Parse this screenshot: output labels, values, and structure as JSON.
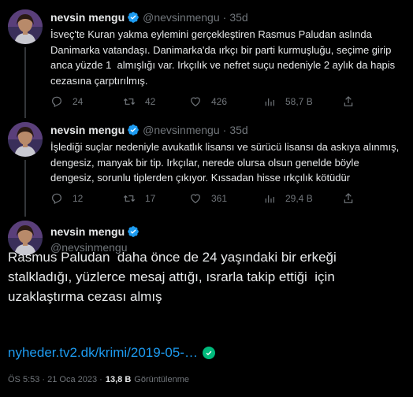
{
  "user": {
    "name": "nevsin mengu",
    "handle": "@nevsinmengu"
  },
  "thread": [
    {
      "time": "35d",
      "text": "İsveç'te Kuran yakma eylemini gerçekleştiren Rasmus Paludan aslında\nDanimarka vatandaşı. Danimarka'da ırkçı bir parti kurmuşluğu, seçime girip\nanca yüzde 1  almışlığı var. Irkçılık ve nefret suçu nedeniyle 2 aylık da hapis\ncezasına çarptırılmış.",
      "replies": "24",
      "retweets": "42",
      "likes": "426",
      "views": "58,7 B"
    },
    {
      "time": "35d",
      "text": "İşlediği suçlar nedeniyle avukatlık lisansı ve sürücü lisansı da askıya alınmış,\ndengesiz, manyak bir tip. Irkçılar, nerede olursa olsun genelde böyle\ndengesiz, sorunlu tiplerden çıkıyor. Kıssadan hisse ırkçılık kötüdür",
      "replies": "12",
      "retweets": "17",
      "likes": "361",
      "views": "29,4 B"
    }
  ],
  "main_tweet": {
    "text": "Rasmus Paludan  daha önce de 24 yaşındaki bir erkeği\nstalkladığı, yüzlerce mesaj attığı, ısrarla takip ettiği  için\nuzaklaştırma cezası almış",
    "link": "nyheder.tv2.dk/krimi/2019-05-…",
    "timestamp": "ÖS 5:53 · 21 Oca 2023 · ",
    "views_count": "13,8 B",
    "views_label": "Görüntülenme"
  },
  "colors": {
    "background": "#000000",
    "text": "#e7e9ea",
    "muted": "#71767b",
    "link": "#1d9bf0",
    "verified": "#1d9bf0",
    "link_badge": "#00ba7c"
  }
}
